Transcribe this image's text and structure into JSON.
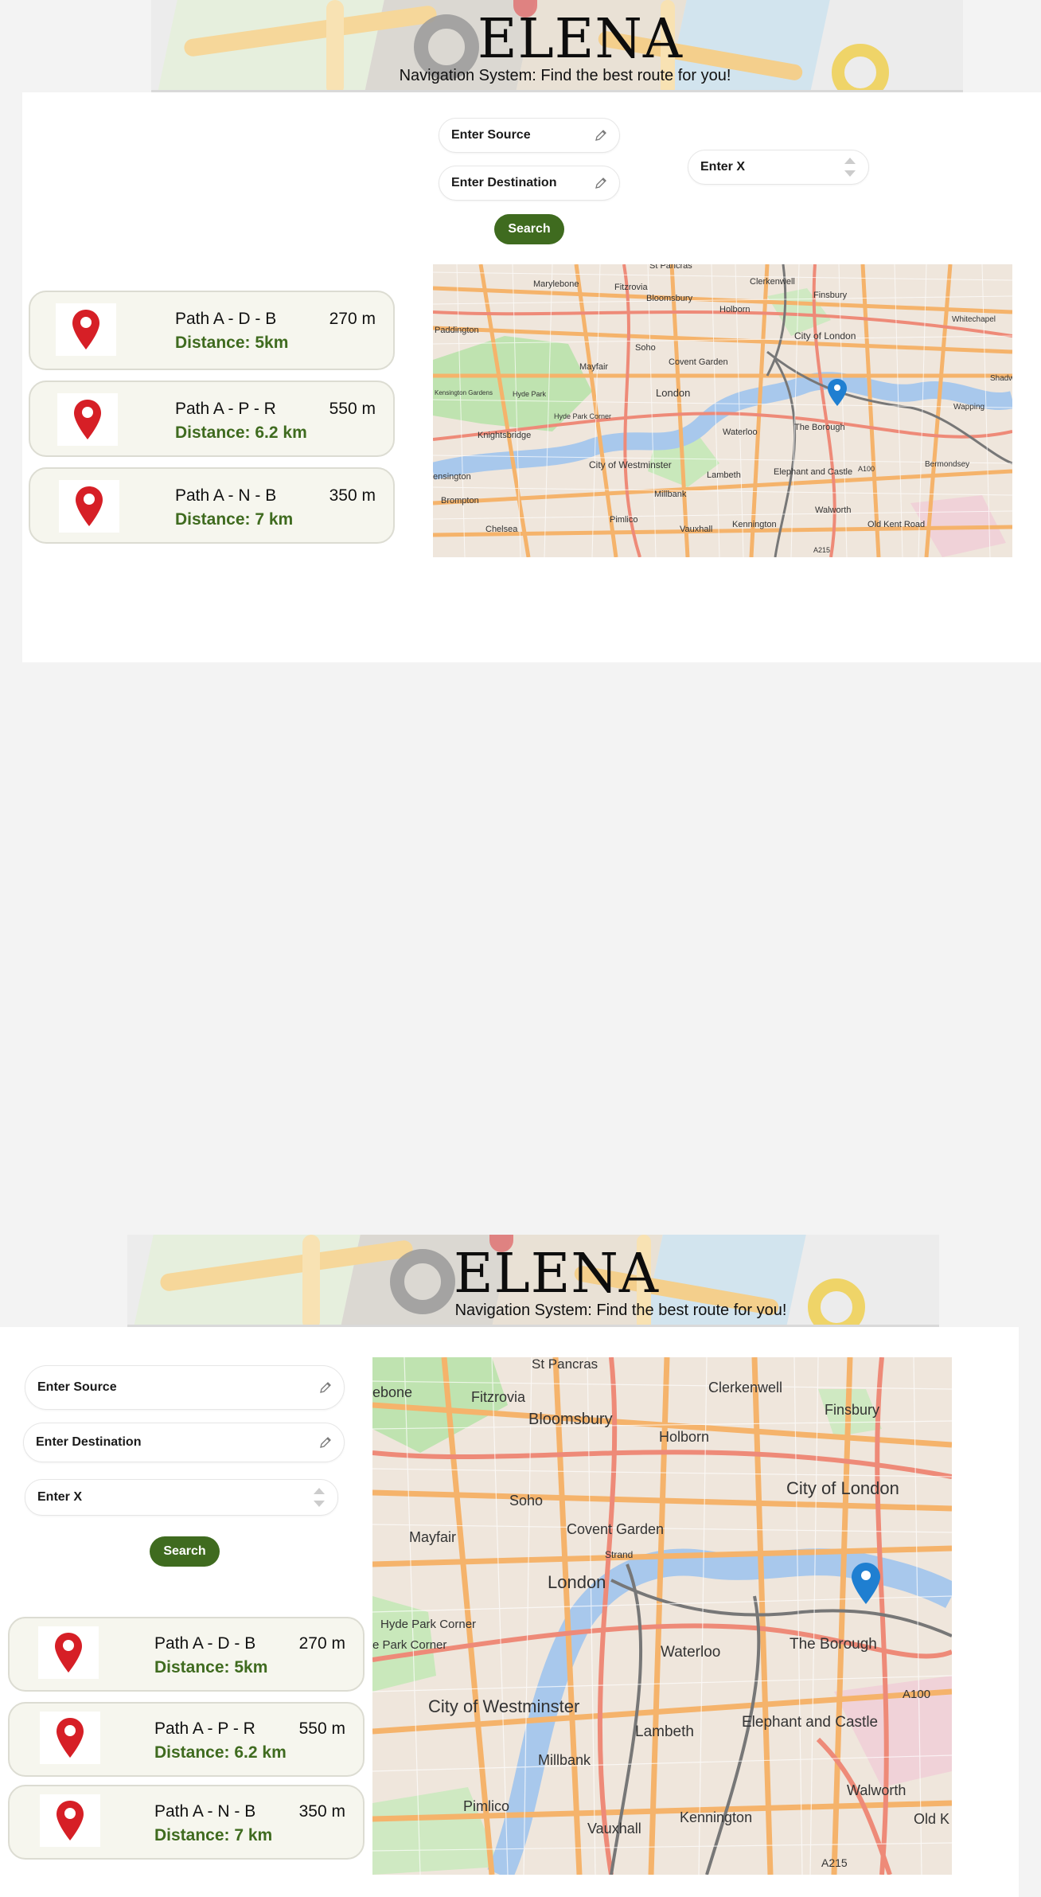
{
  "app": {
    "title": "ELENA",
    "subtitle": "Navigation System: Find the best route for you!"
  },
  "form": {
    "source_placeholder": "Enter Source",
    "destination_placeholder": "Enter Destination",
    "x_placeholder": "Enter X",
    "search_label": "Search"
  },
  "routes": [
    {
      "path": "Path A - D - B",
      "length": "270 m",
      "distance": "Distance: 5km"
    },
    {
      "path": "Path A - P - R",
      "length": "550 m",
      "distance": "Distance: 6.2 km"
    },
    {
      "path": "Path A - N - B",
      "length": "350 m",
      "distance": "Distance: 7 km"
    }
  ],
  "map": {
    "labels": {
      "st_pancras": "St Pancras",
      "marylebone": "Marylebone",
      "fitzrovia": "Fitzrovia",
      "bloomsbury": "Bloomsbury",
      "clerkenwell": "Clerkenwell",
      "finsbury": "Finsbury",
      "holborn": "Holborn",
      "whitechapel": "Whitechapel",
      "paddington": "Paddington",
      "city_of_london": "City of London",
      "soho": "Soho",
      "mayfair": "Mayfair",
      "covent_garden": "Covent Garden",
      "london": "London",
      "hyde_park": "Hyde Park",
      "kensington_gardens": "Kensington Gardens",
      "hyde_park_corner": "Hyde Park Corner",
      "knightsbridge": "Knightsbridge",
      "waterloo": "Waterloo",
      "the_borough": "The Borough",
      "wapping": "Wapping",
      "shadwell": "Shadw",
      "city_of_westminster": "City of Westminster",
      "lambeth": "Lambeth",
      "elephant_and_castle": "Elephant and Castle",
      "bermondsey": "Bermondsey",
      "kensington": "ensington",
      "brompton": "Brompton",
      "millbank": "Millbank",
      "pimlico": "Pimlico",
      "chelsea": "Chelsea",
      "vauxhall": "Vauxhall",
      "kennington": "Kennington",
      "walworth": "Walworth",
      "old_kent_road": "Old Kent Road",
      "a100": "A100",
      "a215": "A215",
      "strand": "Strand",
      "marylebone_cut": "ebone",
      "old_k": "Old K",
      "park_corner_cut": "e Park Corner"
    }
  },
  "colors": {
    "accent_green": "#3f6b1f",
    "pin_red": "#d61f26",
    "marker_blue": "#1f7fd1",
    "card_bg": "#f6f6ee"
  }
}
